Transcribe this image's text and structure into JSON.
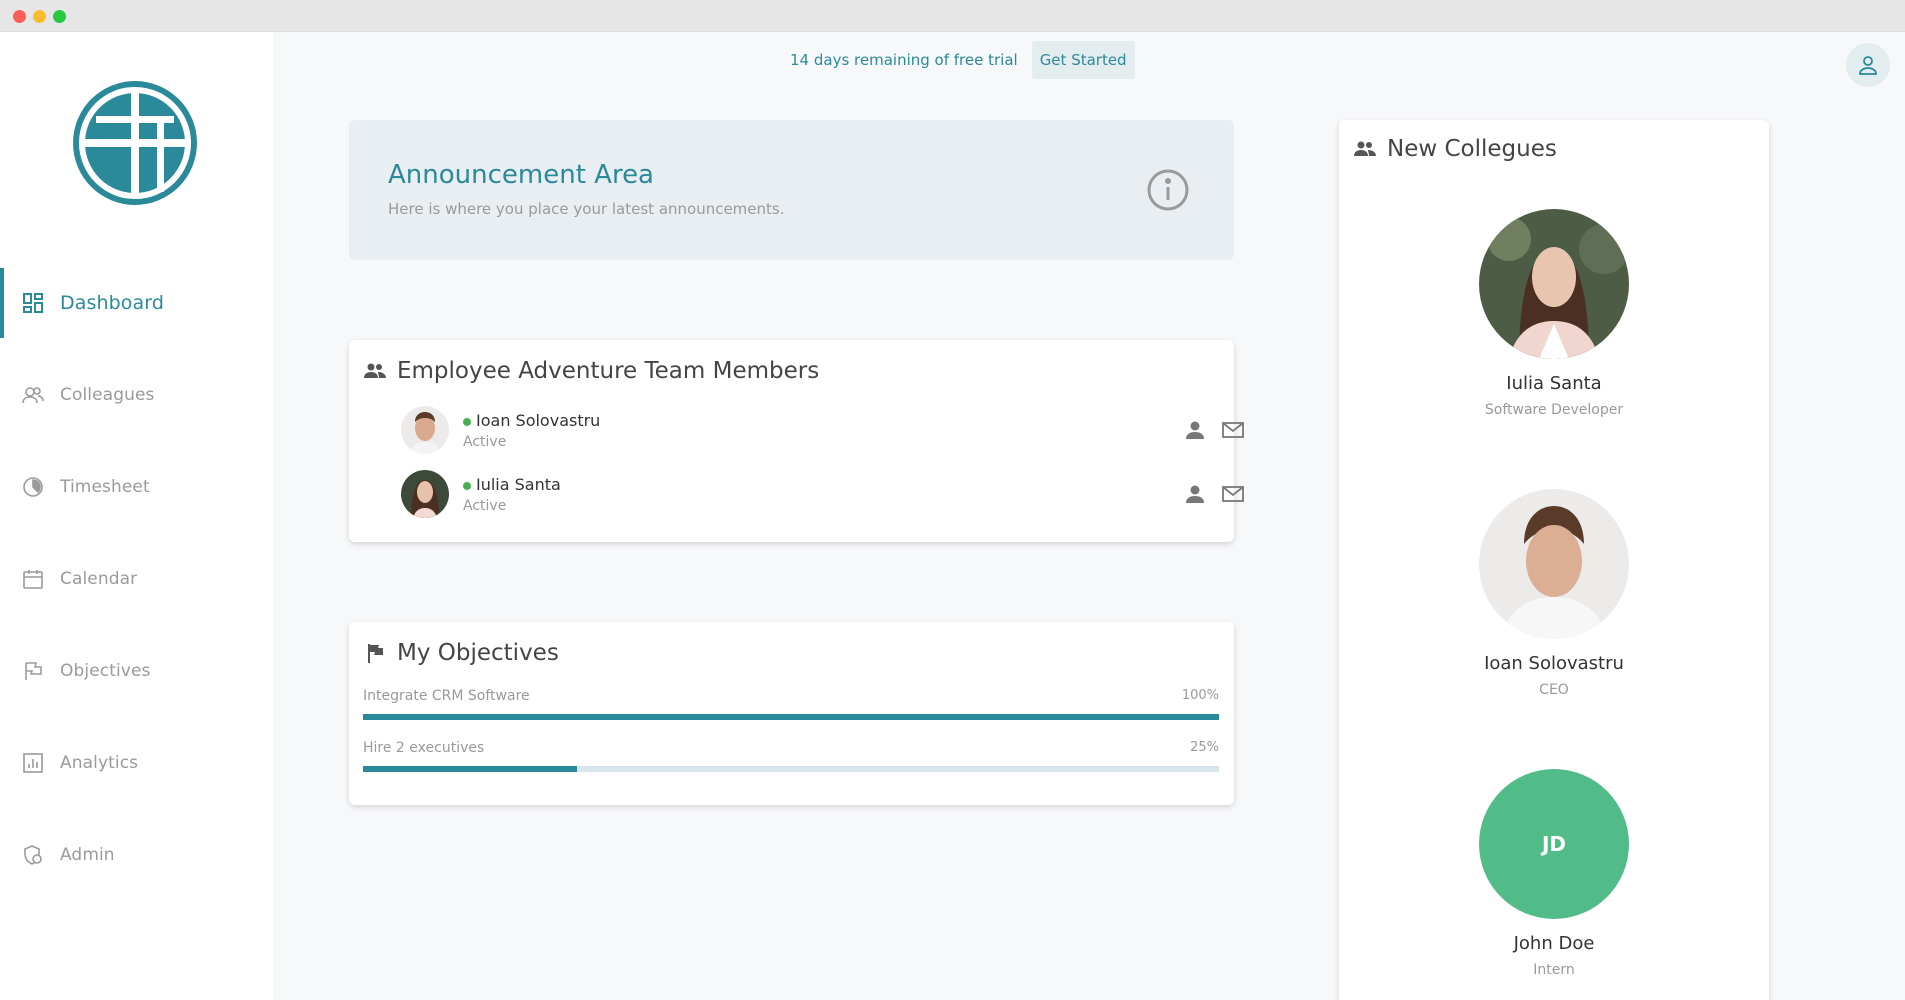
{
  "trial": {
    "message": "14 days remaining of free trial",
    "button_label": "Get Started"
  },
  "sidebar": {
    "items": [
      {
        "label": "Dashboard",
        "icon": "dashboard-icon",
        "active": true
      },
      {
        "label": "Colleagues",
        "icon": "people-icon"
      },
      {
        "label": "Timesheet",
        "icon": "pie-clock-icon"
      },
      {
        "label": "Calendar",
        "icon": "calendar-icon"
      },
      {
        "label": "Objectives",
        "icon": "flag-icon"
      },
      {
        "label": "Analytics",
        "icon": "bar-chart-icon"
      },
      {
        "label": "Admin",
        "icon": "shield-icon"
      }
    ]
  },
  "announcement": {
    "title": "Announcement Area",
    "subtitle": "Here is where you place your latest announcements."
  },
  "team": {
    "title": "Employee Adventure Team Members",
    "members": [
      {
        "name": "Ioan Solovastru",
        "status": "Active"
      },
      {
        "name": "Iulia Santa",
        "status": "Active"
      }
    ]
  },
  "objectives": {
    "title": "My Objectives",
    "items": [
      {
        "name": "Integrate CRM Software",
        "percent_label": "100%",
        "progress": 1.0
      },
      {
        "name": "Hire 2 executives",
        "percent_label": "25%",
        "progress": 0.25
      }
    ]
  },
  "new_colleagues": {
    "title": "New Collegues",
    "people": [
      {
        "name": "Iulia Santa",
        "role": "Software Developer"
      },
      {
        "name": "Ioan Solovastru",
        "role": "CEO"
      },
      {
        "name": "John Doe",
        "role": "Intern",
        "initials": "JD"
      }
    ]
  },
  "colors": {
    "accent": "#2b8a9a",
    "status_active": "#4caf50",
    "initials_avatar": "#52bc89"
  }
}
